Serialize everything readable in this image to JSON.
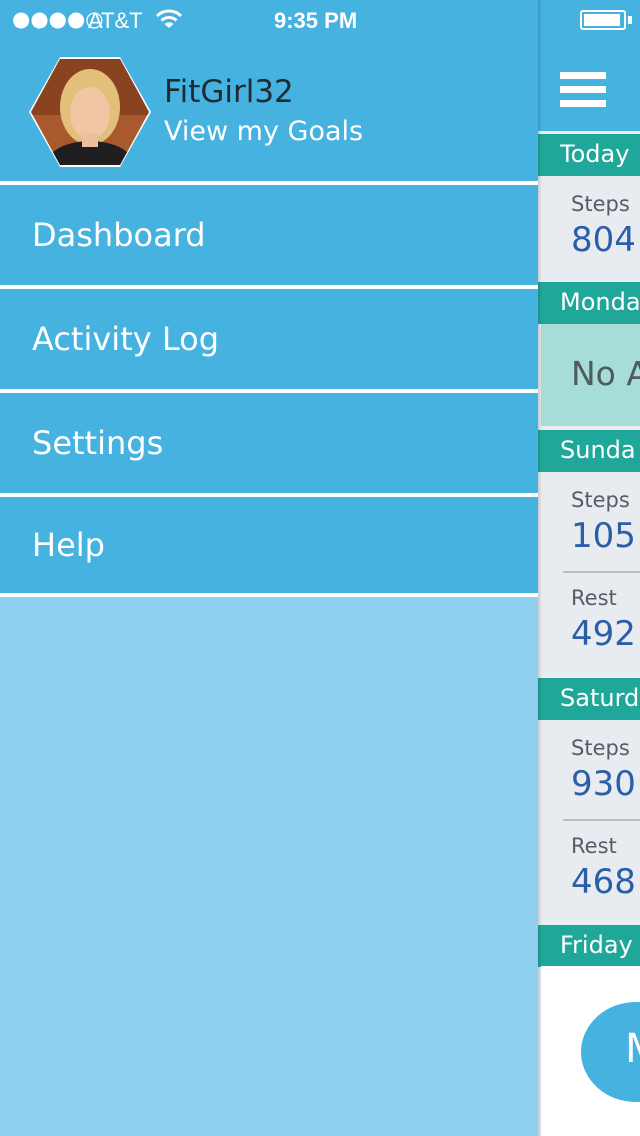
{
  "status_bar": {
    "signal": "●●●●○",
    "carrier": "AT&T",
    "time": "9:35 PM"
  },
  "profile": {
    "username": "FitGirl32",
    "goals_link": "View my Goals"
  },
  "menu": {
    "items": [
      {
        "label": "Dashboard"
      },
      {
        "label": "Activity Log"
      },
      {
        "label": "Settings"
      },
      {
        "label": "Help"
      }
    ]
  },
  "main": {
    "days": [
      {
        "label": "Today",
        "steps_label": "Steps",
        "steps_value": "804"
      },
      {
        "label": "Monda",
        "no_activity": "No A"
      },
      {
        "label": "Sunda",
        "steps_label": "Steps",
        "steps_value": "105",
        "rest_label": "Rest",
        "rest_value": "492"
      },
      {
        "label": "Saturd",
        "steps_label": "Steps",
        "steps_value": "930",
        "rest_label": "Rest",
        "rest_value": "468"
      },
      {
        "label": "Friday"
      }
    ],
    "fab_label": "M"
  },
  "colors": {
    "primary": "#45b2e0",
    "drawer_background": "#8fd0ee",
    "day_header": "#1fa89a",
    "value_text": "#2a5fa8"
  }
}
